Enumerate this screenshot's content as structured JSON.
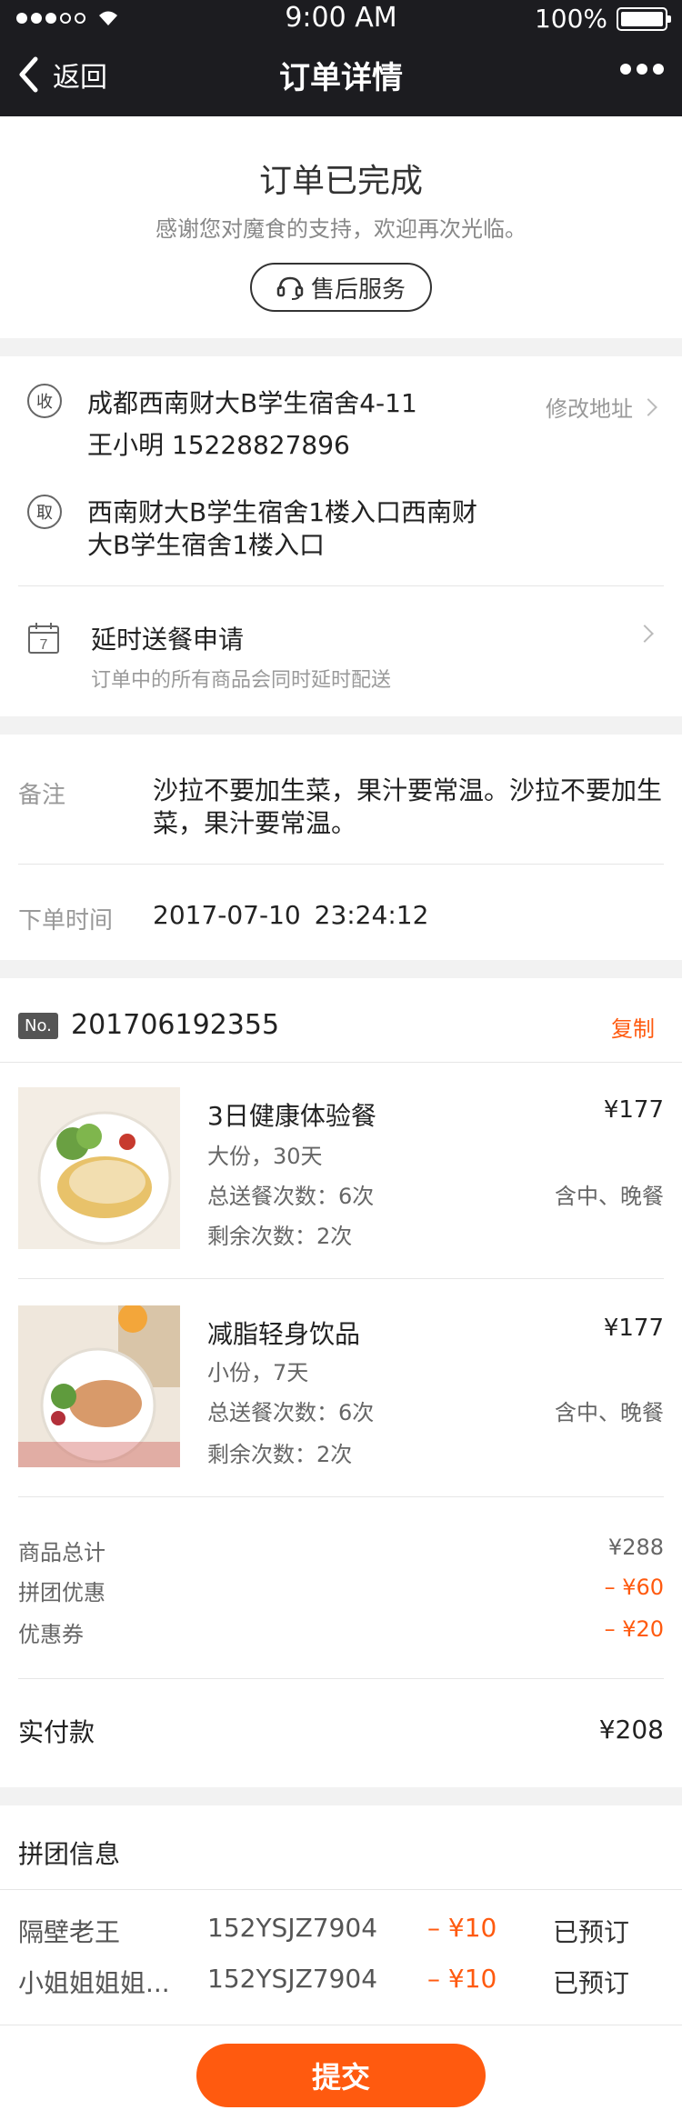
{
  "status_bar": {
    "time": "9:00 AM",
    "battery": "100%"
  },
  "nav": {
    "back_label": "返回",
    "title": "订单详情",
    "more_icon": "more-dots-icon"
  },
  "order_status": {
    "title": "订单已完成",
    "subtitle": "感谢您对魔食的支持，欢迎再次光临。",
    "service_button": "售后服务"
  },
  "address": {
    "receive_tag": "收",
    "receive_line1": "成都西南财大B学生宿舍4-11",
    "receive_line2": "王小明  15228827896",
    "modify_label": "修改地址",
    "pickup_tag": "取",
    "pickup_line1": "西南财大B学生宿舍1楼入口西南财",
    "pickup_line2": "大B学生宿舍1楼入口",
    "delay_icon_day": "7",
    "delay_title": "延时送餐申请",
    "delay_subtitle": "订单中的所有商品会同时延时配送"
  },
  "note": {
    "label": "备注",
    "text": "沙拉不要加生菜，果汁要常温。沙拉不要加生菜，果汁要常温。",
    "time_label": "下单时间",
    "time_value": "2017-07-10  23:24:12"
  },
  "order": {
    "no_badge": "No.",
    "number": "201706192355",
    "copy_label": "复制",
    "products": [
      {
        "name": "3日健康体验餐",
        "spec": "大份，30天",
        "total_count": "总送餐次数：6次",
        "remain_count": "剩余次数：2次",
        "price": "¥177",
        "meals": "含中、晚餐"
      },
      {
        "name": "减脂轻身饮品",
        "spec": "小份，7天",
        "total_count": "总送餐次数：6次",
        "remain_count": "剩余次数：2次",
        "price": "¥177",
        "meals": "含中、晚餐"
      }
    ],
    "summary": {
      "goods_total_label": "商品总计",
      "goods_total": "¥288",
      "group_discount_label": "拼团优惠",
      "group_discount": "– ¥60",
      "coupon_label": "优惠券",
      "coupon": "– ¥20",
      "paid_label": "实付款",
      "paid": "¥208"
    }
  },
  "group": {
    "title": "拼团信息",
    "members": [
      {
        "name": "隔壁老王",
        "code": "152YSJZ7904",
        "amount": "– ¥10",
        "status": "已预订"
      },
      {
        "name": "小姐姐姐姐...",
        "code": "152YSJZ7904",
        "amount": "– ¥10",
        "status": "已预订"
      }
    ]
  },
  "submit_label": "提交",
  "colors": {
    "accent": "#ff5a0f",
    "header": "#1c1c20"
  }
}
